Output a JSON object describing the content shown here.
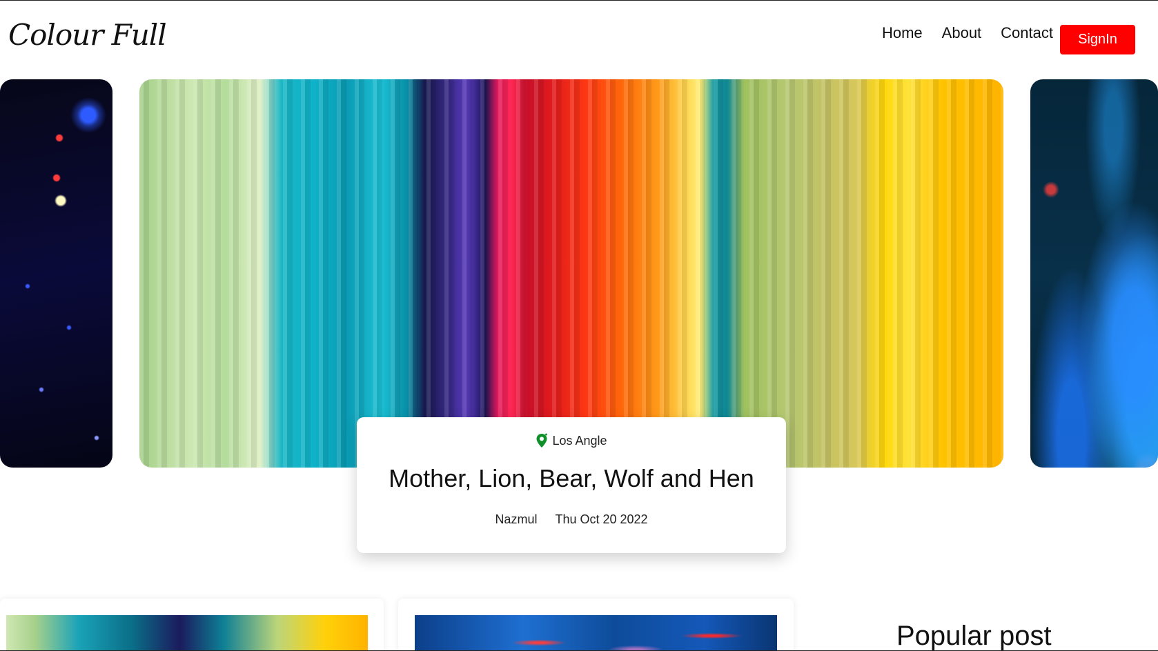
{
  "header": {
    "logo": "Colour Full",
    "nav": [
      "Home",
      "About",
      "Contact"
    ],
    "signin_label": "SignIn"
  },
  "featured": {
    "location": "Los Angle",
    "title": "Mother, Lion, Bear, Wolf and Hen",
    "author": "Nazmul",
    "date": "Thu Oct 20 2022"
  },
  "sidebar": {
    "popular_title": "Popular post"
  },
  "colors": {
    "signin_bg": "#ff0000",
    "pin_icon": "#0f8f2a"
  },
  "icons": {
    "location": "map-pin-icon"
  }
}
